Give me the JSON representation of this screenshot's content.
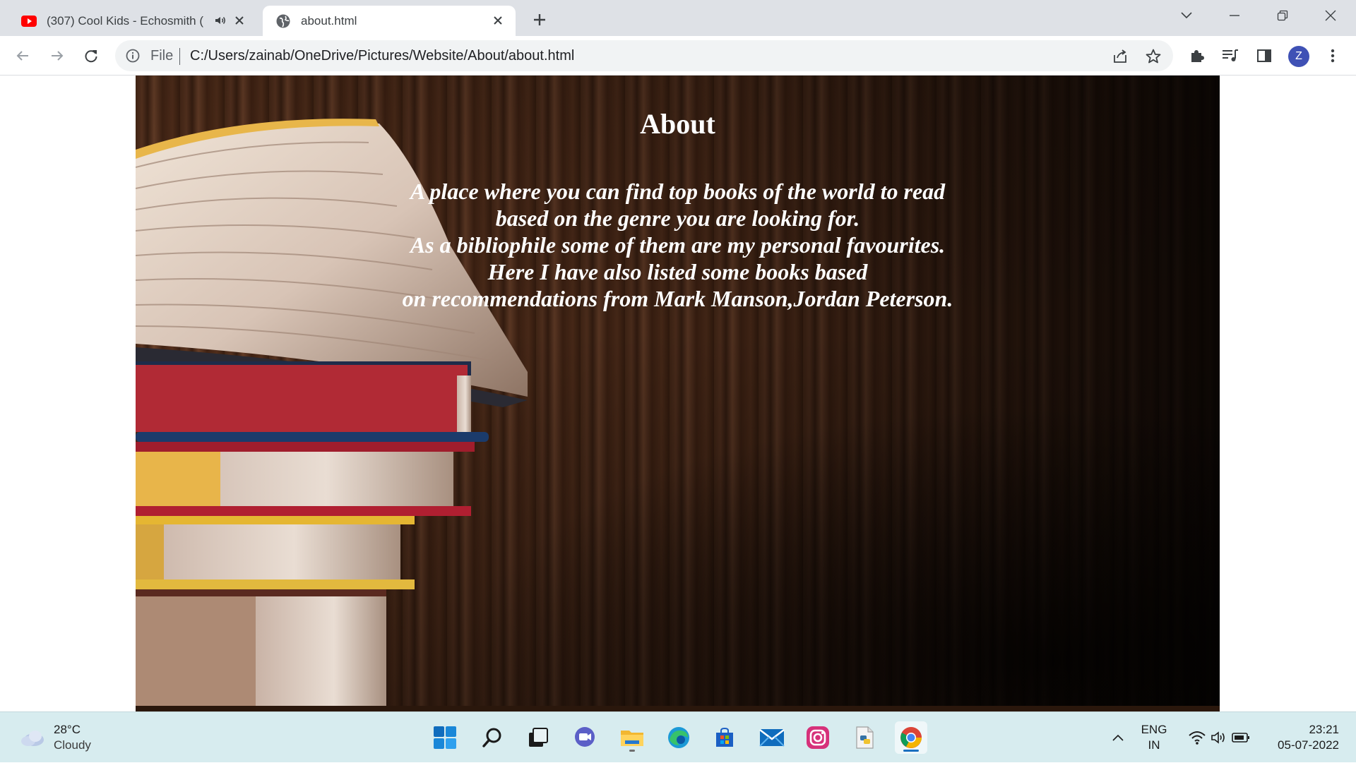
{
  "browser": {
    "tabs": [
      {
        "title": "(307) Cool Kids - Echosmith (",
        "favicon": "youtube-icon",
        "audio": true,
        "active": false
      },
      {
        "title": "about.html",
        "favicon": "globe-icon",
        "audio": false,
        "active": true
      }
    ],
    "omnibox": {
      "scheme_label": "File",
      "url": "C:/Users/zainab/OneDrive/Pictures/Website/About/about.html"
    },
    "profile_initial": "Z"
  },
  "page": {
    "heading": "About",
    "paragraph_lines": [
      "A place where you can find top books of the world to read",
      "based on the genre you are looking for.",
      "As a bibliophile some of them are my personal favourites.",
      "Here I have also listed some books based",
      "on recommendations from Mark Manson,Jordan Peterson."
    ]
  },
  "taskbar": {
    "weather": {
      "temp": "28°C",
      "condition": "Cloudy"
    },
    "apps": [
      "start-icon",
      "search-icon",
      "task-view-icon",
      "chat-icon",
      "file-explorer-icon",
      "edge-icon",
      "store-icon",
      "mail-icon",
      "instagram-icon",
      "python-file-icon",
      "chrome-icon"
    ],
    "language": {
      "line1": "ENG",
      "line2": "IN"
    },
    "clock": {
      "time": "23:21",
      "date": "05-07-2022"
    }
  },
  "colors": {
    "tabstrip": "#dee1e6",
    "taskbar": "#d7ecef",
    "profile": "#3f51b5",
    "text_white": "#ffffff"
  }
}
